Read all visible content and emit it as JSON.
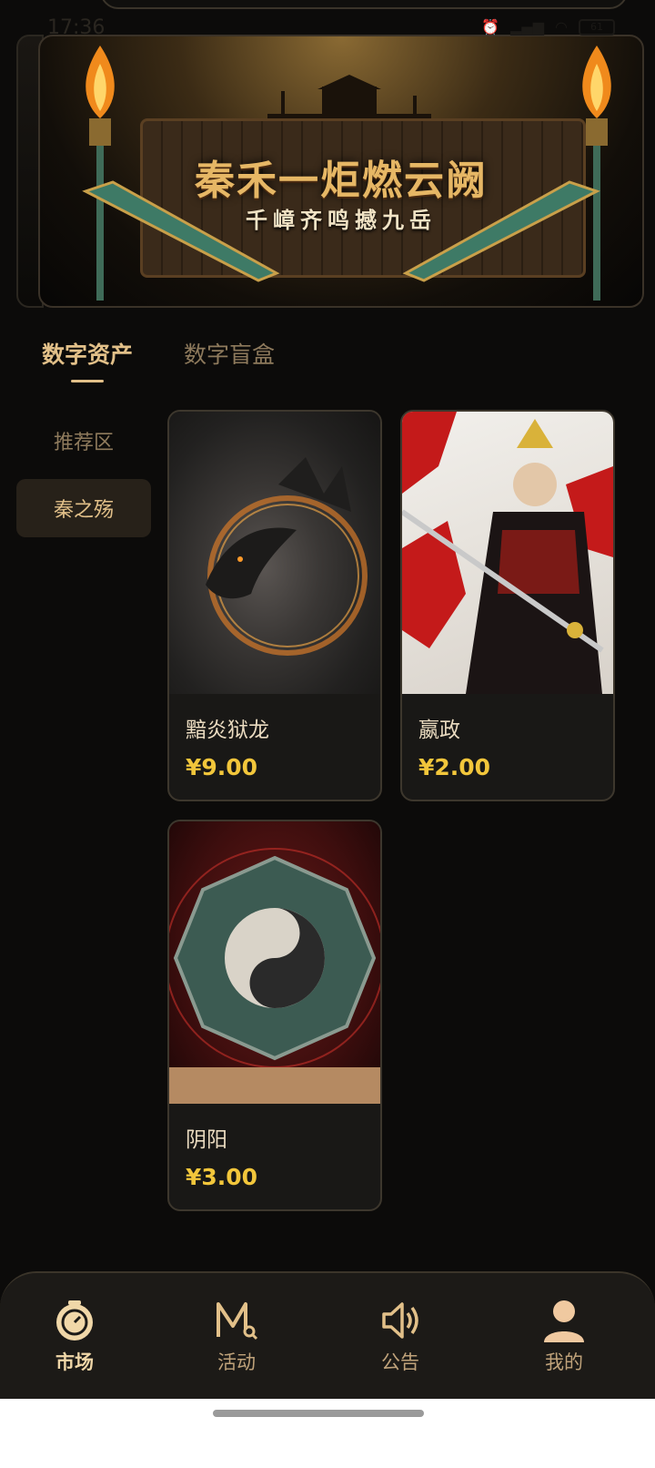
{
  "status_bar": {
    "time": "17:36",
    "battery": "61"
  },
  "banner": {
    "title": "秦禾一炬燃云阙",
    "subtitle": "千嶂齐鸣撼九岳"
  },
  "tabs": [
    {
      "label": "数字资产",
      "active": true
    },
    {
      "label": "数字盲盒",
      "active": false
    }
  ],
  "categories": [
    {
      "label": "推荐区",
      "active": false
    },
    {
      "label": "秦之殇",
      "active": true
    }
  ],
  "products": [
    {
      "name": "黯炎狱龙",
      "price": "¥9.00",
      "image_icon": "dragon-artwork"
    },
    {
      "name": "嬴政",
      "price": "¥2.00",
      "image_icon": "warrior-artwork"
    },
    {
      "name": "阴阳",
      "price": "¥3.00",
      "image_icon": "yinyang-artwork"
    }
  ],
  "bottom_nav": [
    {
      "label": "市场",
      "icon": "market-clock-icon",
      "active": true
    },
    {
      "label": "活动",
      "icon": "activity-m-icon",
      "active": false
    },
    {
      "label": "公告",
      "icon": "speaker-icon",
      "active": false
    },
    {
      "label": "我的",
      "icon": "profile-icon",
      "active": false
    }
  ],
  "colors": {
    "accent": "#e2c089",
    "price": "#f2c63b",
    "background": "#0c0b0a"
  }
}
